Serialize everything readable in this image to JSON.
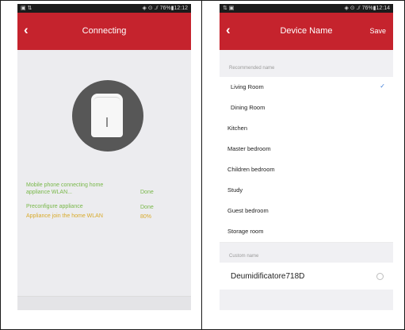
{
  "left_screen": {
    "status": {
      "left": "▣ ⇅",
      "right": "◈ ⊙ .⫽ 76%▮12:12"
    },
    "title": "Connecting",
    "back_icon": "‹",
    "steps": [
      {
        "label": "Mobile phone connecting home appliance WLAN...",
        "status": "Done",
        "color": "#79b84a"
      },
      {
        "label": "Preconfigure appliance",
        "status": "Done",
        "color": "#79b84a"
      },
      {
        "label": "Appliance join the home WLAN",
        "status": "80%",
        "color": "#d8aa2a"
      }
    ],
    "icons": {
      "back": "back-arrow-icon",
      "device": "dehumidifier-icon"
    }
  },
  "right_screen": {
    "status": {
      "left": "⇅ ▣",
      "right": "◈ ⊙ .⫽ 76%▮12:14"
    },
    "title": "Device Name",
    "back_icon": "‹",
    "save": "Save",
    "recommended_caption": "Recommended name",
    "names": [
      {
        "label": "Living Room",
        "selected": true
      },
      {
        "label": "Dining Room",
        "selected": false
      },
      {
        "label": "Kitchen",
        "selected": false
      },
      {
        "label": "Master bedroom",
        "selected": false
      },
      {
        "label": "Children bedroom",
        "selected": false
      },
      {
        "label": "Study",
        "selected": false
      },
      {
        "label": "Guest bedroom",
        "selected": false
      },
      {
        "label": "Storage room",
        "selected": false
      }
    ],
    "check_icon": "✓",
    "custom_caption": "Custom name",
    "custom_value": "Deumidificatore718D",
    "icons": {
      "check": "checkmark-icon",
      "clear": "clear-input-icon"
    }
  }
}
